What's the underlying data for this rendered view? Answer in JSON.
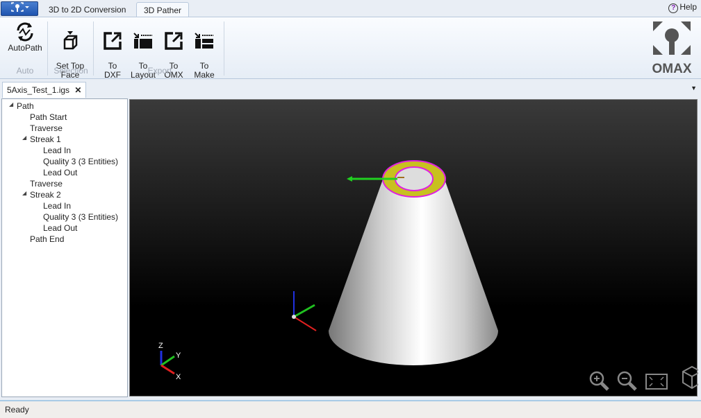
{
  "app_menu": {
    "icon": "omax-logo-icon"
  },
  "ribbon_tabs": [
    "3D to 2D Conversion",
    "3D Pather"
  ],
  "active_tab": "3D Pather",
  "help": "Help",
  "ribbon": {
    "groups": [
      {
        "label": "Auto",
        "buttons": [
          {
            "label": "AutoPath",
            "icon": "autopath-icon"
          }
        ]
      },
      {
        "label": "Selection",
        "buttons": [
          {
            "label": "Set Top\nFace",
            "icon": "set-top-face-icon"
          }
        ]
      },
      {
        "label": "Export",
        "buttons": [
          {
            "label": "To\nDXF",
            "icon": "export-dxf-icon"
          },
          {
            "label": "To\nLayout",
            "icon": "export-layout-icon"
          },
          {
            "label": "To\nOMX",
            "icon": "export-omx-icon"
          },
          {
            "label": "To\nMake",
            "icon": "export-make-icon"
          }
        ]
      }
    ],
    "logo": "OMAX"
  },
  "document_tab": "5Axis_Test_1.igs",
  "tree": [
    {
      "label": "Path",
      "level": 0,
      "expanded": true
    },
    {
      "label": "Path Start",
      "level": 1
    },
    {
      "label": "Traverse",
      "level": 1
    },
    {
      "label": "Streak 1",
      "level": 1,
      "expanded": true
    },
    {
      "label": "Lead In",
      "level": 2
    },
    {
      "label": "Quality 3 (3 Entities)",
      "level": 2
    },
    {
      "label": "Lead Out",
      "level": 2
    },
    {
      "label": "Traverse",
      "level": 1
    },
    {
      "label": "Streak 2",
      "level": 1,
      "expanded": true
    },
    {
      "label": "Lead In",
      "level": 2
    },
    {
      "label": "Quality 3 (3 Entities)",
      "level": 2
    },
    {
      "label": "Lead Out",
      "level": 2
    },
    {
      "label": "Path End",
      "level": 1
    }
  ],
  "axes": {
    "x": "X",
    "y": "Y",
    "z": "Z"
  },
  "view_tools": [
    "zoom-in-icon",
    "zoom-out-icon",
    "zoom-fit-icon",
    "view-cube-icon"
  ],
  "colors": {
    "background": "#000000",
    "top_face": "#c8c020",
    "edge": "#e020e0",
    "x_axis": "#e02020",
    "y_axis": "#20c020",
    "z_axis": "#2030e0"
  },
  "status": "Ready"
}
